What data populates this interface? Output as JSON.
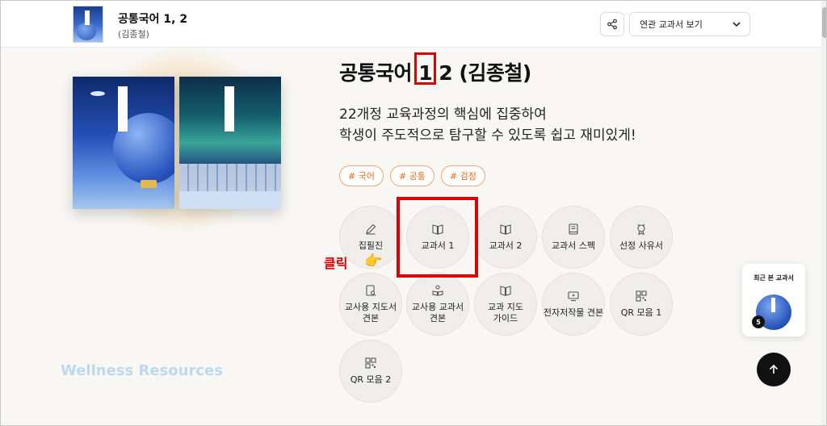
{
  "header": {
    "title": "공통국어 1, 2",
    "subtitle": "(김종철)",
    "related_select": "연관 교과서 보기"
  },
  "main": {
    "title": "공통국어 1 2 (김종철)",
    "desc_line1": "22개정 교육과정의 핵심에 집중하여",
    "desc_line2": "학생이 주도적으로 탐구할 수 있도록 쉽고 재미있게!",
    "tags": [
      "# 국어",
      "# 공통",
      "# 검정"
    ]
  },
  "tiles": [
    {
      "label": "집필진",
      "icon": "pen-icon"
    },
    {
      "label": "교과서 1",
      "icon": "book-open-icon"
    },
    {
      "label": "교과서 2",
      "icon": "book-open-icon"
    },
    {
      "label": "교과서 스펙",
      "icon": "book-icon"
    },
    {
      "label": "선정 사유서",
      "icon": "award-icon"
    },
    {
      "label": "교사용 지도서\n견본",
      "icon": "guide-book-icon"
    },
    {
      "label": "교사용 교과서\n견본",
      "icon": "teacher-book-icon"
    },
    {
      "label": "교과 지도\n가이드",
      "icon": "book-open-icon"
    },
    {
      "label": "전자저작물 견본",
      "icon": "monitor-icon"
    },
    {
      "label": "QR 모음 1",
      "icon": "qr-icon"
    },
    {
      "label": "QR 모음 2",
      "icon": "qr-icon"
    }
  ],
  "annotation": {
    "click_label": "클릭",
    "hand_emoji": "👉"
  },
  "watermark": "Wellness Resources",
  "recent": {
    "title": "최근 본 교과서",
    "count": "5"
  },
  "colors": {
    "highlight": "#e00000",
    "tag_border": "#f2a66b",
    "tag_text": "#e86e1a"
  }
}
